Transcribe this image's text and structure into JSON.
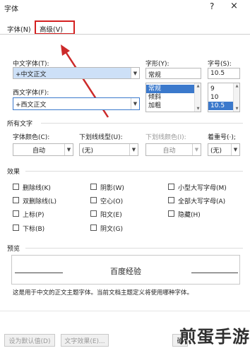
{
  "window": {
    "title": "字体",
    "help_icon": "?",
    "close_icon": "×"
  },
  "tabs": [
    {
      "label": "字体(N)"
    },
    {
      "label": "高级(V)"
    }
  ],
  "fields": {
    "chinese_font": {
      "label": "中文字体(T):",
      "value": "+中文正文"
    },
    "western_font": {
      "label": "西文字体(F):",
      "value": "+西文正文"
    },
    "style": {
      "label": "字形(Y):",
      "value": "常规",
      "options": [
        "常规",
        "倾斜",
        "加粗"
      ],
      "selected": "常规"
    },
    "size": {
      "label": "字号(S):",
      "value": "10.5",
      "options": [
        "9",
        "10",
        "10.5"
      ],
      "selected": "10.5"
    }
  },
  "all_text": {
    "heading": "所有文字",
    "font_color": {
      "label": "字体颜色(C):",
      "value": "自动"
    },
    "underline_style": {
      "label": "下划线线型(U):",
      "value": "(无)"
    },
    "underline_color": {
      "label": "下划线颜色(I):",
      "value": "自动"
    },
    "emphasis": {
      "label": "着重号(·);",
      "value": "(无)"
    }
  },
  "effects": {
    "heading": "效果",
    "items": [
      {
        "label": "删除线(K)"
      },
      {
        "label": "阴影(W)"
      },
      {
        "label": "小型大写字母(M)"
      },
      {
        "label": "双删除线(L)"
      },
      {
        "label": "空心(O)"
      },
      {
        "label": "全部大写字母(A)"
      },
      {
        "label": "上标(P)"
      },
      {
        "label": "阳文(E)"
      },
      {
        "label": "隐藏(H)"
      },
      {
        "label": "下标(B)"
      },
      {
        "label": "阴文(G)"
      }
    ]
  },
  "preview": {
    "heading": "预览",
    "sample": "百度经验",
    "note": "这是用于中文的正文主题字体。当前文档主题定义将使用哪种字体。"
  },
  "buttons": {
    "set_default": "设为默认值(D)",
    "text_effects": "文字效果(E)...",
    "ok": "确"
  },
  "watermark": "煎蛋手游",
  "colors": {
    "highlight": "#d42020",
    "selection": "#3b79cc"
  }
}
